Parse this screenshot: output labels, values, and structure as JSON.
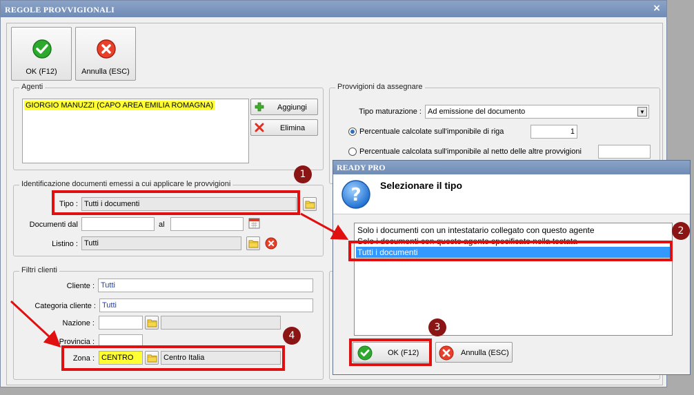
{
  "window": {
    "title": "REGOLE PROVVIGIONALI",
    "close_glyph": "×"
  },
  "toolbar": {
    "ok_label": "OK (F12)",
    "cancel_label": "Annulla (ESC)"
  },
  "agenti": {
    "legend": "Agenti",
    "items": [
      "GIORGIO MANUZZI (CAPO AREA EMILIA ROMAGNA)"
    ],
    "add_label": "Aggiungi",
    "remove_label": "Elimina"
  },
  "provvigioni": {
    "legend": "Provvigioni da assegnare",
    "tipo_label": "Tipo maturazione :",
    "tipo_value": "Ad emissione del documento",
    "opt1_label": "Percentuale calcolate sull'imponibile di riga",
    "opt1_value": "1",
    "opt2_label": "Percentuale calcolata sull'imponibile al netto delle altre provvigioni",
    "opt2_value": ""
  },
  "identificazione": {
    "legend": "Identificazione documenti emessi a cui applicare le provvigioni",
    "tipo_label": "Tipo :",
    "tipo_value": "Tutti i documenti",
    "dal_label": "Documenti dal",
    "al_label": "al",
    "dal_value": "",
    "al_value": "",
    "listino_label": "Listino :",
    "listino_value": "Tutti"
  },
  "filtri": {
    "legend": "Filtri clienti",
    "cliente_label": "Cliente :",
    "cliente_value": "Tutti",
    "categoria_label": "Categoria cliente :",
    "categoria_value": "Tutti",
    "nazione_label": "Nazione :",
    "nazione_value": "",
    "nazione_desc": "",
    "provincia_label": "Provincia :",
    "provincia_value": "",
    "zona_label": "Zona :",
    "zona_value": "CENTRO",
    "zona_desc": "Centro Italia"
  },
  "dialog": {
    "title": "READY PRO",
    "heading": "Selezionare il tipo",
    "options": [
      "Solo i documenti con un intestatario collegato con questo agente",
      "Solo i documenti con questo agente specificato nella testata",
      "Tutti i documenti"
    ],
    "selected_index": 2,
    "ok_label": "OK (F12)",
    "cancel_label": "Annulla (ESC)"
  },
  "annotations": {
    "badge1": "1",
    "badge2": "2",
    "badge3": "3",
    "badge4": "4"
  },
  "colors": {
    "annotation_red": "#e01010",
    "highlight_yellow": "#ffff33",
    "selection_blue": "#3399ff",
    "badge_dark_red": "#8b1414"
  }
}
